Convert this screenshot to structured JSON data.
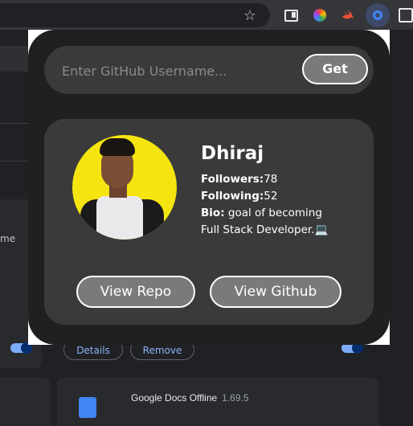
{
  "browser": {
    "toolbar_icons": [
      "star-icon",
      "sidebar-icon",
      "color-picker-icon",
      "swift-icon",
      "github-extension-icon",
      "puzzle-icon"
    ],
    "colors": {
      "toolbar": "#35363a",
      "page": "#202124",
      "toggle_on": "#7cacf8"
    }
  },
  "background_page": {
    "left_card_text": "me",
    "details_label": "Details",
    "remove_label": "Remove",
    "extension_name": "Google Docs Offline",
    "extension_version": "1.69.5"
  },
  "popup": {
    "search": {
      "placeholder": "Enter GitHub Username...",
      "value": "",
      "button_label": "Get"
    },
    "profile": {
      "name": "Dhiraj",
      "followers_label": "Followers:",
      "followers_value": "78",
      "following_label": "Following:",
      "following_value": "52",
      "bio_label": "Bio:",
      "bio_line1": " goal of becoming",
      "bio_line2": "Full Stack Developer.💻"
    },
    "actions": {
      "view_repo_label": "View Repo",
      "view_github_label": "View Github"
    },
    "colors": {
      "popup_bg": "#202020",
      "panel_bg": "#3a3a3a",
      "button_bg": "#7a7a7a",
      "avatar_bg": "#f6e411"
    }
  }
}
